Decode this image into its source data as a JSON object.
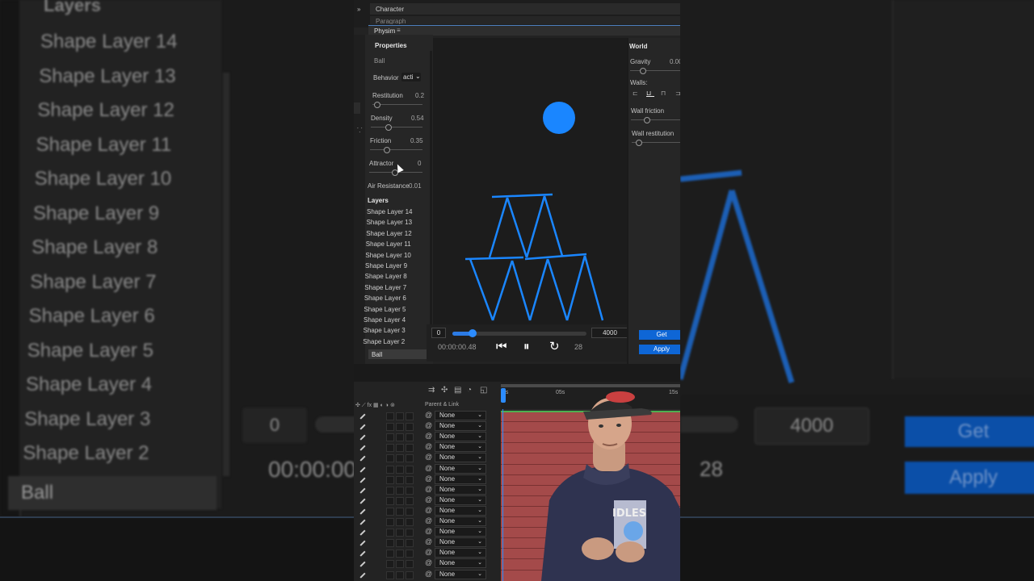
{
  "tabs": {
    "character": "Character",
    "paragraph": "Paragraph",
    "panel": "Physim"
  },
  "properties": {
    "title": "Properties",
    "object": "Ball",
    "behavior_label": "Behavior",
    "behavior_value": "acti",
    "params": [
      {
        "label": "Restitution",
        "value": "0.2"
      },
      {
        "label": "Density",
        "value": "0.54"
      },
      {
        "label": "Friction",
        "value": "0.35"
      },
      {
        "label": "Attractor",
        "value": "0"
      }
    ],
    "air_resistance_label": "Air Resistance",
    "air_resistance_value": "0.01"
  },
  "layers": {
    "title": "Layers",
    "items": [
      "Shape Layer 14",
      "Shape Layer 13",
      "Shape Layer 12",
      "Shape Layer 11",
      "Shape Layer 10",
      "Shape Layer 9",
      "Shape Layer 8",
      "Shape Layer 7",
      "Shape Layer 6",
      "Shape Layer 5",
      "Shape Layer 4",
      "Shape Layer 3",
      "Shape Layer 2"
    ],
    "selected": "Ball"
  },
  "world": {
    "title": "World",
    "gravity_label": "Gravity",
    "gravity_value": "0.00",
    "walls_label": "Walls:",
    "wall_friction_label": "Wall friction",
    "wall_restitution_label": "Wall restitution",
    "get_label": "Get",
    "apply_label": "Apply"
  },
  "playback": {
    "start": "0",
    "end": "4000",
    "progress": 0.15,
    "timecode": "00:00:00.48",
    "frame": "28"
  },
  "timeline": {
    "parent_header": "Parent & Link",
    "ruler_marks": [
      "0s",
      "05s",
      "15s"
    ],
    "parent_value": "None",
    "row_count": 16
  },
  "background": {
    "left_layers": [
      "Shape Layer 14",
      "Shape Layer 13",
      "Shape Layer 12",
      "Shape Layer 11",
      "Shape Layer 10",
      "Shape Layer 9",
      "Shape Layer 8",
      "Shape Layer 7",
      "Shape Layer 6",
      "Shape Layer 5",
      "Shape Layer 4",
      "Shape Layer 3",
      "Shape Layer 2"
    ],
    "left_title": "Layers",
    "left_selected": "Ball",
    "left_start": "0",
    "left_time": "00:00:00",
    "right_end": "4000",
    "right_frame": "28",
    "right_get": "Get",
    "right_apply": "Apply"
  },
  "colors": {
    "accent": "#2c8cff",
    "button": "#0e66d6",
    "ball": "#1a86ff",
    "layer_bar": "#a44a4a"
  },
  "presenter": {
    "shirt_text": "IDLES"
  }
}
